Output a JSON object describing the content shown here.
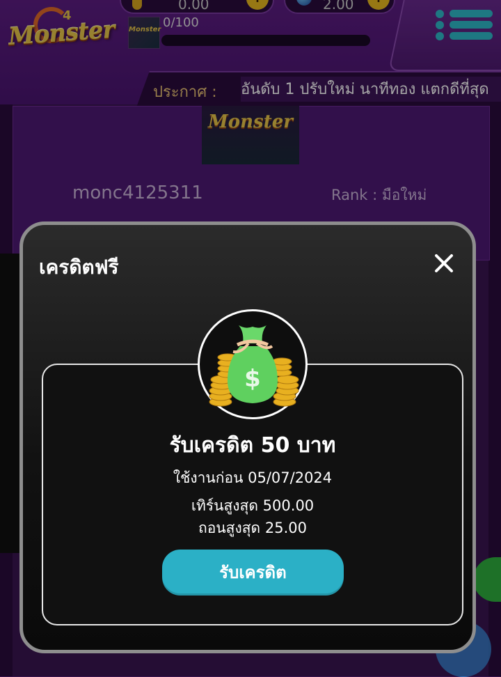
{
  "header": {
    "logo_text": "Monster",
    "logo_number": "4",
    "coin_balance": "0.00",
    "gem_balance": "2.00",
    "xp_progress": "0/100",
    "xp_fraction": 0,
    "announcement_label": "ประกาศ :",
    "announcement_text": "อันดับ 1 ปรับใหม่ นาทีทอง แตกดีที่สุด"
  },
  "profile": {
    "logo_text": "Monster",
    "username": "monc4125311",
    "rank": "Rank : มือใหม่"
  },
  "modal": {
    "title": "เครดิตฟรี",
    "reward_title": "รับเครดิต 50 บาท",
    "expire_text": "ใช้งานก่อน 05/07/2024",
    "turnover_text": "เทิร์นสูงสุด 500.00",
    "withdraw_text": "ถอนสูงสุด 25.00",
    "claim_button": "รับเครดิต"
  },
  "colors": {
    "accent": "#2bb0c6",
    "header_bg": "#5c1d82",
    "modal_border": "#8e8e8e"
  }
}
